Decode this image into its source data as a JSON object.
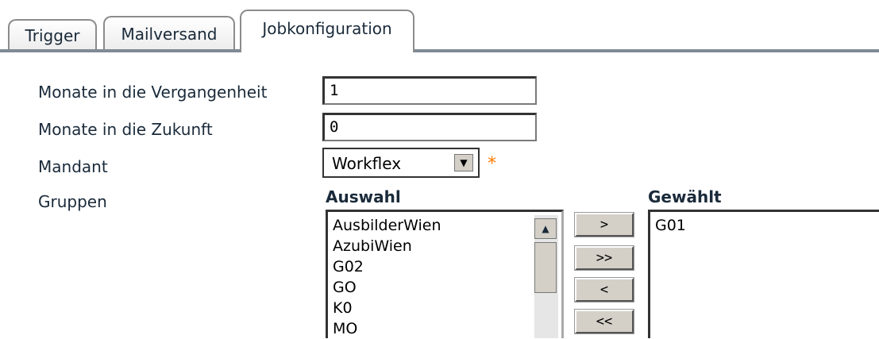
{
  "tabs": [
    {
      "label": "Trigger",
      "active": false
    },
    {
      "label": "Mailversand",
      "active": false
    },
    {
      "label": "Jobkonfiguration",
      "active": true
    }
  ],
  "form": {
    "past_months": {
      "label": "Monate in die Vergangenheit",
      "value": "1"
    },
    "future_months": {
      "label": "Monate in die Zukunft",
      "value": "0"
    },
    "client": {
      "label": "Mandant",
      "value": "Workflex",
      "required_marker": "*"
    },
    "groups": {
      "label": "Gruppen"
    }
  },
  "selection": {
    "available_heading": "Auswahl",
    "available_items": [
      "AusbilderWien",
      "AzubiWien",
      "G02",
      "GO",
      "K0",
      "MO"
    ],
    "chosen_heading": "Gewählt",
    "chosen_items": [
      "G01"
    ],
    "buttons": {
      "add": ">",
      "add_all": ">>",
      "remove": "<",
      "remove_all": "<<"
    }
  },
  "colors": {
    "required": "#ff7a00",
    "button_face": "#d4d0c8"
  },
  "icons": {
    "dropdown": "triangle-down-icon",
    "scroll_up": "triangle-up-icon"
  }
}
